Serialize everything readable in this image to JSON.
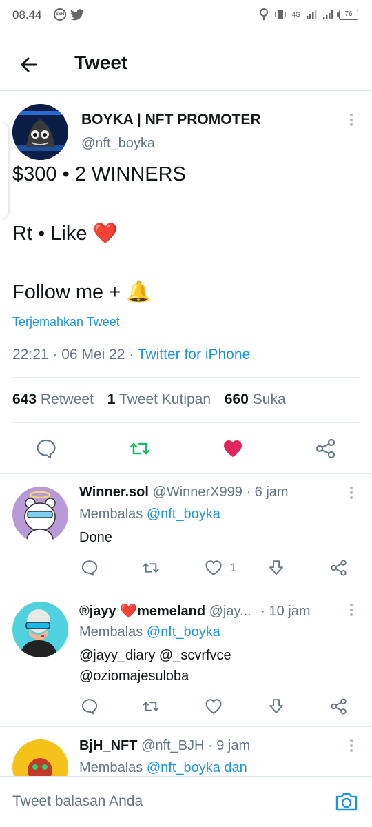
{
  "status_bar": {
    "time": "08.44",
    "ssh_label": "SSH",
    "network": "4G",
    "battery": "76"
  },
  "header": {
    "title": "Tweet"
  },
  "tweet": {
    "author_name": "BOYKA | NFT PROMOTER",
    "author_handle": "@nft_boyka",
    "lines": [
      "$300 • 2 WINNERS",
      "Rt • Like",
      "Follow me +"
    ],
    "heart_emoji": "❤️",
    "bell_emoji": "🔔",
    "translate_label": "Terjemahkan Tweet",
    "time": "22:21",
    "date": "06 Mei 22",
    "separator": "·",
    "source": "Twitter for iPhone",
    "retweets_count": "643",
    "retweets_label": "Retweet",
    "quotes_count": "1",
    "quotes_label": "Tweet Kutipan",
    "likes_count": "660",
    "likes_label": "Suka",
    "liked": true,
    "retweeted": true
  },
  "replies": [
    {
      "name": "Winner.sol",
      "handle": "@WinnerX999",
      "time": "· 6 jam",
      "replying_prefix": "Membalas",
      "replying_to": "@nft_boyka",
      "text_lines": [
        "Done"
      ],
      "like_count": "1"
    },
    {
      "name": "®jayy ❤️memeland",
      "handle": "@jay...",
      "time": "· 10 jam",
      "replying_prefix": "Membalas",
      "replying_to": "@nft_boyka",
      "text_lines": [
        "@jayy_diary @_scvrfvce",
        "@oziomajesuloba"
      ],
      "like_count": ""
    },
    {
      "name": "BjH_NFT",
      "handle": "@nft_BJH",
      "time": "· 9 jam",
      "replying_prefix": "Membalas",
      "replying_to": "@nft_boyka dan",
      "text_lines": [],
      "like_count": ""
    }
  ],
  "reply_bar": {
    "placeholder": "Tweet balasan Anda"
  },
  "colors": {
    "accent": "#1b95e0",
    "retweet_green": "#17bf63",
    "like_pink": "#e0245e",
    "secondary_text": "#657786"
  }
}
